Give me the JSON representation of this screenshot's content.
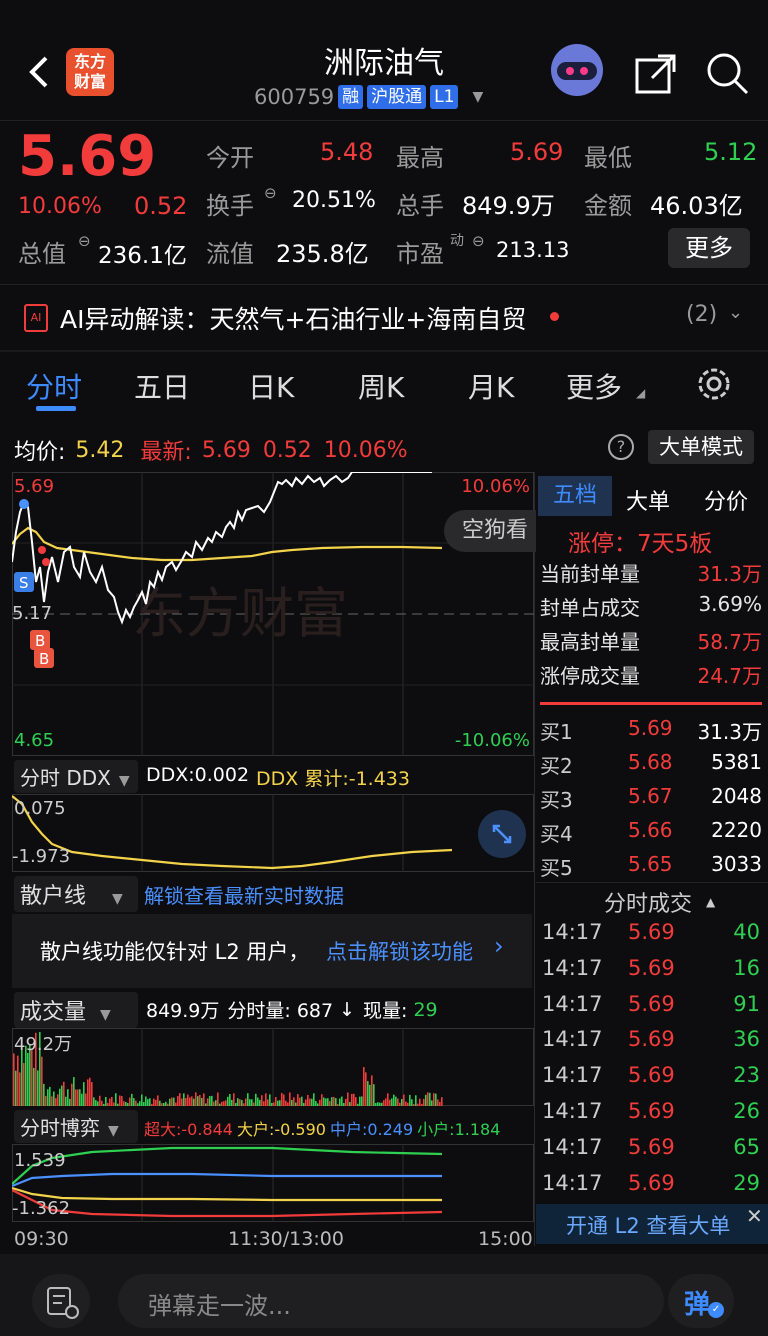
{
  "header": {
    "back_icon": "chevron-left-icon",
    "logo_text": "东方\n财富",
    "stock_name": "洲际油气",
    "stock_code": "600759",
    "tags": [
      "融",
      "沪股通",
      "L1"
    ],
    "share_icon": "share-icon",
    "search_icon": "search-icon",
    "avatar_icon": "robot-avatar-icon"
  },
  "quote": {
    "price": "5.69",
    "change_pct": "10.06%",
    "change_abs": "0.52",
    "open_label": "今开",
    "open_value": "5.48",
    "high_label": "最高",
    "high_value": "5.69",
    "low_label": "最低",
    "low_value": "5.12",
    "turnover_label": "换手",
    "turnover_value": "20.51%",
    "volume_label": "总手",
    "volume_value": "849.9万",
    "amount_label": "金额",
    "amount_value": "46.03亿",
    "mktcap_label": "总值",
    "mktcap_value": "236.1亿",
    "float_label": "流值",
    "float_value": "235.8亿",
    "pe_label": "市盈",
    "pe_sup": "动",
    "pe_value": "213.13",
    "more_button": "更多"
  },
  "ai_banner": {
    "text": "AI异动解读：天然气+石油行业+海南自贸",
    "count": "(2)"
  },
  "tabs": [
    "分时",
    "五日",
    "日K",
    "周K",
    "月K",
    "更多"
  ],
  "chart_header": {
    "avg_label": "均价:",
    "avg_value": "5.42",
    "latest_label": "最新:",
    "latest_value": "5.69",
    "latest_change": "0.52",
    "latest_pct": "10.06%",
    "help_icon": "question-icon",
    "mode_button": "大单模式"
  },
  "price_chart": {
    "top_left": "5.69",
    "mid_left": "5.17",
    "bottom_left": "4.65",
    "top_right": "10.06%",
    "bottom_right": "-10.06%",
    "watermark": "东方财富",
    "overlay_button": "空狗看",
    "markers": [
      "S",
      "B",
      "B"
    ]
  },
  "ddx": {
    "selector": "分时 DDX",
    "ddx_text": "DDX:0.002",
    "ddx_sum": "DDX 累计:-1.433",
    "top_value": "0.075",
    "bottom_value": "-1.973"
  },
  "retail": {
    "selector": "散户线",
    "unlock_link": "解锁查看最新实时数据",
    "notice_text": "散户线功能仅针对 L2 用户，",
    "notice_link": "点击解锁该功能",
    "notice_arrow": "›"
  },
  "volume": {
    "selector": "成交量",
    "total": "849.9万",
    "per_min": "分时量: 687",
    "arrow": "↓",
    "current_label": "现量:",
    "current_value": "29",
    "top_value": "49.2万"
  },
  "game": {
    "selector": "分时博弈",
    "super_large": "超大:-0.844",
    "large": "大户:-0.590",
    "medium": "中户:0.249",
    "small": "小户:1.184",
    "top_value": "1.539",
    "bottom_value": "-1.362"
  },
  "time_axis": [
    "09:30",
    "11:30/13:00",
    "15:00"
  ],
  "side_tabs": [
    "五档",
    "大单",
    "分价"
  ],
  "limit_info": {
    "limit_label": "涨停：7天5板",
    "rows": [
      {
        "label": "当前封单量",
        "value": "31.3万"
      },
      {
        "label": "封单占成交",
        "value": "3.69%"
      },
      {
        "label": "最高封单量",
        "value": "58.7万"
      },
      {
        "label": "涨停成交量",
        "value": "24.7万"
      }
    ]
  },
  "order_book": [
    {
      "label": "买1",
      "price": "5.69",
      "volume": "31.3万"
    },
    {
      "label": "买2",
      "price": "5.68",
      "volume": "5381"
    },
    {
      "label": "买3",
      "price": "5.67",
      "volume": "2048"
    },
    {
      "label": "买4",
      "price": "5.66",
      "volume": "2220"
    },
    {
      "label": "买5",
      "price": "5.65",
      "volume": "3033"
    }
  ],
  "trades_header": "分时成交",
  "trades": [
    {
      "time": "14:17",
      "price": "5.69",
      "vol": "40"
    },
    {
      "time": "14:17",
      "price": "5.69",
      "vol": "16"
    },
    {
      "time": "14:17",
      "price": "5.69",
      "vol": "91"
    },
    {
      "time": "14:17",
      "price": "5.69",
      "vol": "36"
    },
    {
      "time": "14:17",
      "price": "5.69",
      "vol": "23"
    },
    {
      "time": "14:17",
      "price": "5.69",
      "vol": "26"
    },
    {
      "time": "14:17",
      "price": "5.69",
      "vol": "65"
    },
    {
      "time": "14:17",
      "price": "5.69",
      "vol": "29"
    }
  ],
  "l2_banner": "开通 L2 查看大单",
  "bottom_bar": {
    "danmu_placeholder": "弹幕走一波...",
    "danmu_button": "弹"
  },
  "colors": {
    "up": "#f23b3b",
    "down": "#2fcf52",
    "accent": "#3d8bff",
    "avg_line": "#f2d34b"
  }
}
